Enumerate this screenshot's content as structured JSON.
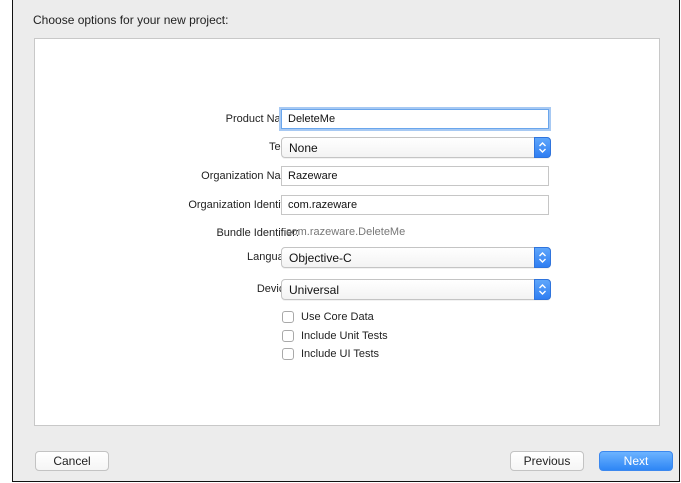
{
  "dialog": {
    "title": "Choose options for your new project:"
  },
  "form": {
    "product_name": {
      "label": "Product Name:",
      "value": "DeleteMe"
    },
    "team": {
      "label": "Team:",
      "value": "None"
    },
    "organization_name": {
      "label": "Organization Name:",
      "value": "Razeware"
    },
    "organization_identifier": {
      "label": "Organization Identifier:",
      "value": "com.razeware"
    },
    "bundle_identifier": {
      "label": "Bundle Identifier:",
      "value": "com.razeware.DeleteMe"
    },
    "language": {
      "label": "Language:",
      "value": "Objective-C"
    },
    "devices": {
      "label": "Devices:",
      "value": "Universal"
    },
    "checkboxes": {
      "use_core_data": {
        "label": "Use Core Data",
        "checked": false
      },
      "include_unit_tests": {
        "label": "Include Unit Tests",
        "checked": false
      },
      "include_ui_tests": {
        "label": "Include UI Tests",
        "checked": false
      }
    }
  },
  "buttons": {
    "cancel": "Cancel",
    "previous": "Previous",
    "next": "Next"
  },
  "colors": {
    "accent": "#2e86f5",
    "focus_ring": "#a7c9f3",
    "sheet_background": "#ececec"
  },
  "icons": {
    "popup_indicator": "chevron-up-down-icon"
  }
}
